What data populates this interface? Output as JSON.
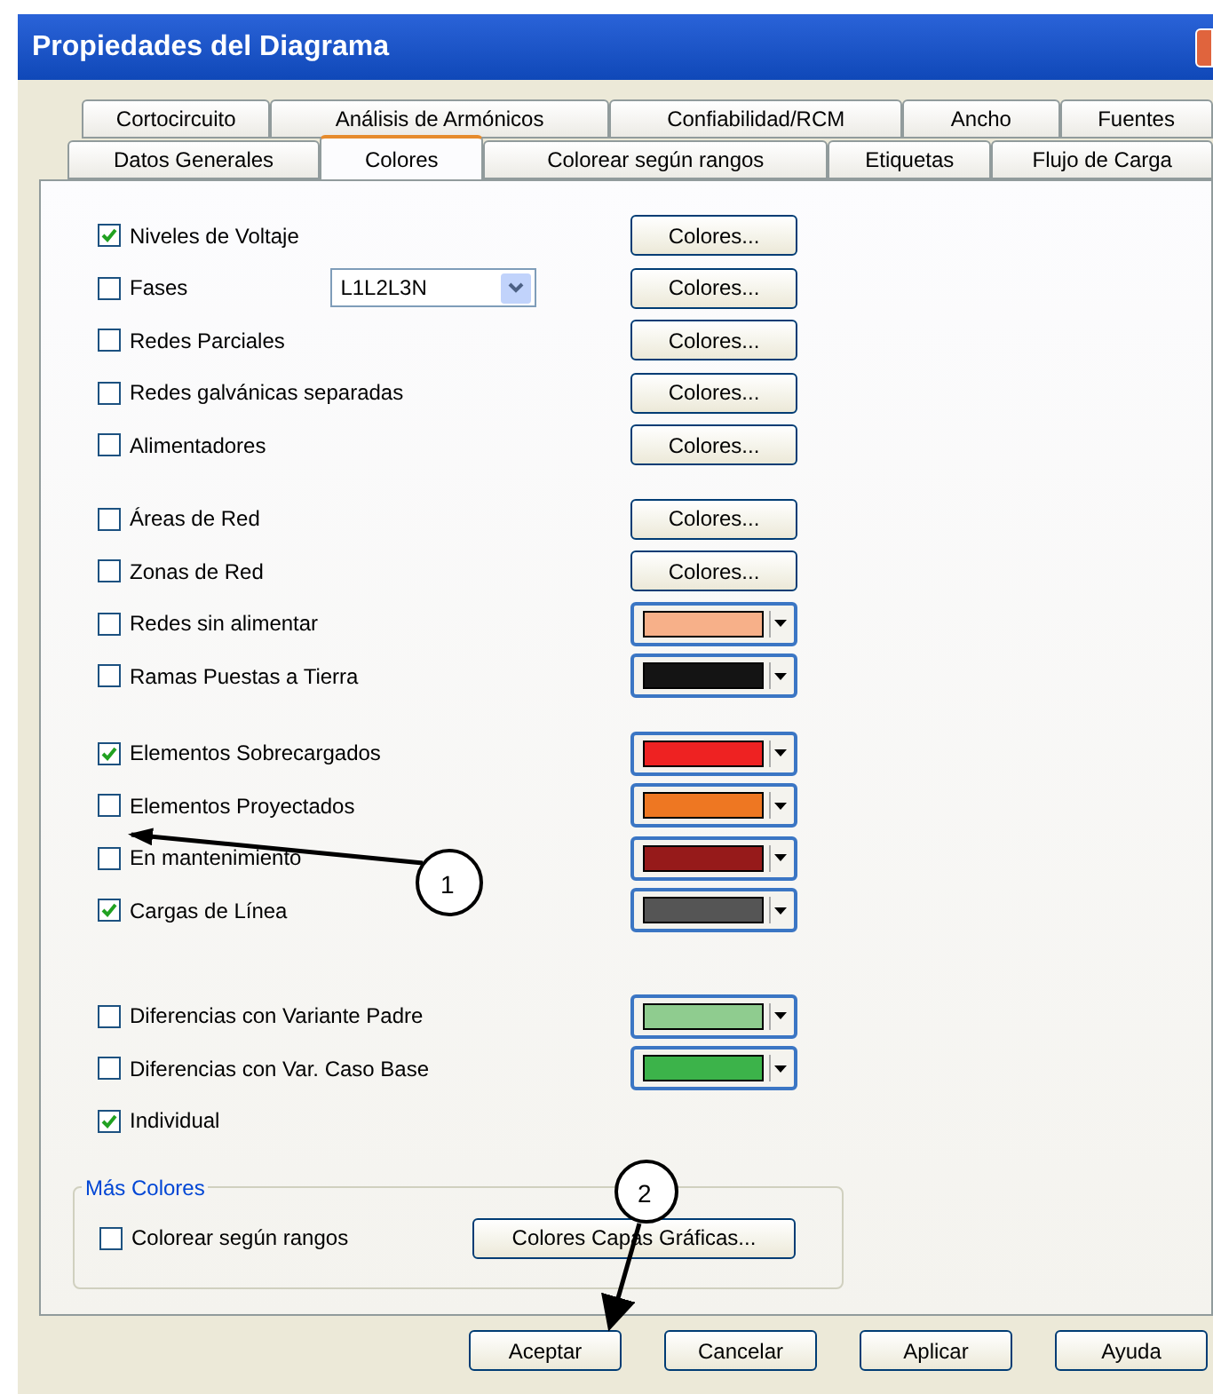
{
  "window": {
    "title": "Propiedades del Diagrama"
  },
  "tab_rows": [
    [
      {
        "label": "Cortocircuito",
        "selected": false
      },
      {
        "label": "Análisis de Armónicos",
        "selected": false
      },
      {
        "label": "Confiabilidad/RCM",
        "selected": false
      },
      {
        "label": "Ancho",
        "selected": false
      },
      {
        "label": "Fuentes",
        "selected": false
      }
    ],
    [
      {
        "label": "Datos Generales",
        "selected": false
      },
      {
        "label": "Colores",
        "selected": true
      },
      {
        "label": "Colorear según rangos",
        "selected": false
      },
      {
        "label": "Etiquetas",
        "selected": false
      },
      {
        "label": "Flujo de Carga",
        "selected": false
      }
    ]
  ],
  "sections": [
    [
      {
        "label": "Niveles de Voltaje",
        "checked": true,
        "kind": "button",
        "button": "Colores..."
      },
      {
        "label": "Fases",
        "checked": false,
        "kind": "button",
        "combo": "L1L2L3N",
        "button": "Colores..."
      },
      {
        "label": "Redes Parciales",
        "checked": false,
        "kind": "button",
        "button": "Colores..."
      },
      {
        "label": "Redes galvánicas separadas",
        "checked": false,
        "kind": "button",
        "button": "Colores..."
      },
      {
        "label": "Alimentadores",
        "checked": false,
        "kind": "button",
        "button": "Colores..."
      }
    ],
    [
      {
        "label": "Áreas de Red",
        "checked": false,
        "kind": "button",
        "button": "Colores..."
      },
      {
        "label": "Zonas de Red",
        "checked": false,
        "kind": "button",
        "button": "Colores..."
      },
      {
        "label": "Redes sin alimentar",
        "checked": false,
        "kind": "swatch",
        "color": "#f7b089"
      },
      {
        "label": "Ramas Puestas a Tierra",
        "checked": false,
        "kind": "swatch",
        "color": "#141414"
      }
    ],
    [
      {
        "label": "Elementos Sobrecargados",
        "checked": true,
        "kind": "swatch",
        "color": "#ee2222"
      },
      {
        "label": "Elementos Proyectados",
        "checked": false,
        "kind": "swatch",
        "color": "#ee7722"
      },
      {
        "label": "En mantenimiento",
        "checked": false,
        "kind": "swatch",
        "color": "#961a1a"
      },
      {
        "label": "Cargas de Línea",
        "checked": true,
        "kind": "swatch",
        "color": "#555555"
      }
    ],
    [
      {
        "label": "Diferencias con Variante Padre",
        "checked": false,
        "kind": "swatch",
        "color": "#8fcc8f"
      },
      {
        "label": "Diferencias con Var. Caso Base",
        "checked": false,
        "kind": "swatch",
        "color": "#3cb34a"
      },
      {
        "label": "Individual",
        "checked": true,
        "kind": "plain"
      }
    ]
  ],
  "more_colors": {
    "title": "Más Colores",
    "checkbox": {
      "label": "Colorear según rangos",
      "checked": false
    },
    "button": "Colores Capas Gráficas..."
  },
  "buttons": [
    "Aceptar",
    "Cancelar",
    "Aplicar",
    "Ayuda"
  ],
  "annotations": [
    {
      "label": "1"
    },
    {
      "label": "2"
    }
  ]
}
